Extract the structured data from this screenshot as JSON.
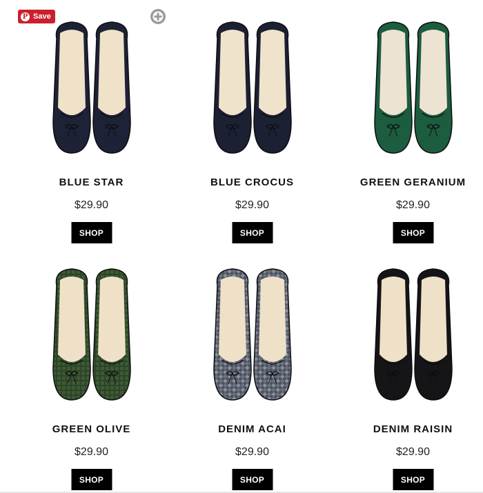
{
  "pinterest": {
    "save_label": "Save",
    "logo": "P"
  },
  "products": [
    {
      "name": "BLUE STAR",
      "price": "$29.90",
      "cta": "SHOP",
      "color": "#1d2236",
      "insole": "#efe2c9",
      "pattern": "plain"
    },
    {
      "name": "BLUE CROCUS",
      "price": "$29.90",
      "cta": "SHOP",
      "color": "#1c2033",
      "insole": "#efe3cc",
      "pattern": "plain"
    },
    {
      "name": "GREEN GERANIUM",
      "price": "$29.90",
      "cta": "SHOP",
      "color": "#1c5c3f",
      "insole": "#ede3d2",
      "pattern": "plain"
    },
    {
      "name": "GREEN OLIVE",
      "price": "$29.90",
      "cta": "SHOP",
      "color": "#2e4429",
      "insole": "#efe1c8",
      "pattern": "croc"
    },
    {
      "name": "DENIM ACAI",
      "price": "$29.90",
      "cta": "SHOP",
      "color": "#4d5360",
      "insole": "#efe1c8",
      "pattern": "quilt"
    },
    {
      "name": "DENIM RAISIN",
      "price": "$29.90",
      "cta": "SHOP",
      "color": "#151518",
      "insole": "#efe1c8",
      "pattern": "plain"
    }
  ]
}
